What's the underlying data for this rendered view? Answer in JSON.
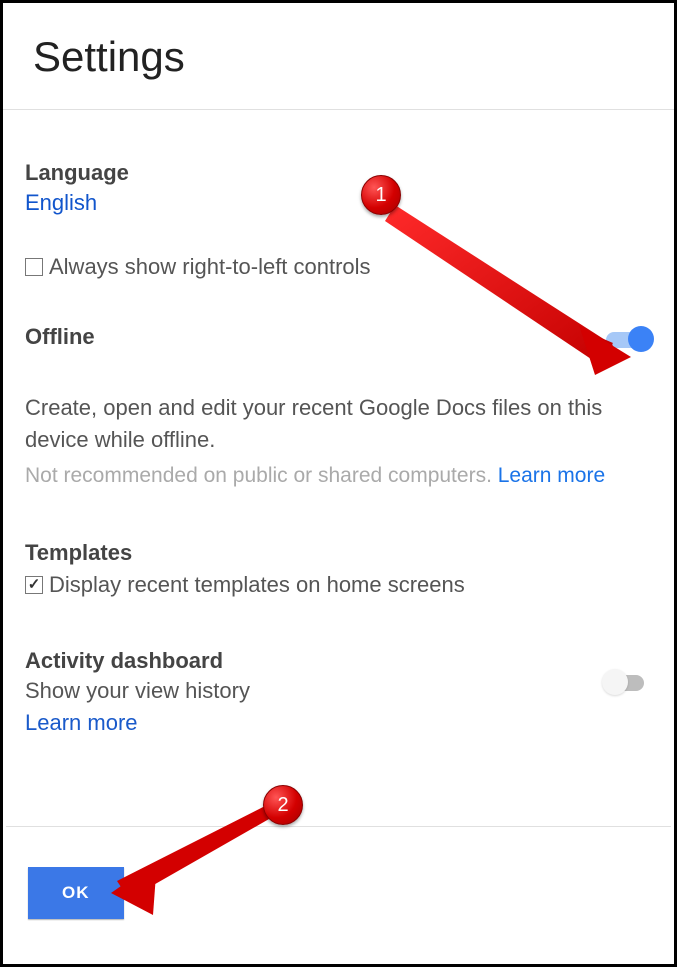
{
  "title": "Settings",
  "language": {
    "label": "Language",
    "value": "English",
    "rtl_checkbox_label": "Always show right-to-left controls",
    "rtl_checked": false
  },
  "offline": {
    "label": "Offline",
    "toggle_on": true,
    "description": "Create, open and edit your recent Google Docs files on this device while offline.",
    "warning": "Not recommended on public or shared computers.",
    "learn_more": "Learn more"
  },
  "templates": {
    "label": "Templates",
    "checkbox_label": "Display recent templates on home screens",
    "checked": true
  },
  "activity": {
    "label": "Activity dashboard",
    "description": "Show your view history",
    "learn_more": "Learn more",
    "toggle_on": false
  },
  "footer": {
    "ok_label": "OK"
  },
  "annotations": {
    "badge1": "1",
    "badge2": "2"
  }
}
